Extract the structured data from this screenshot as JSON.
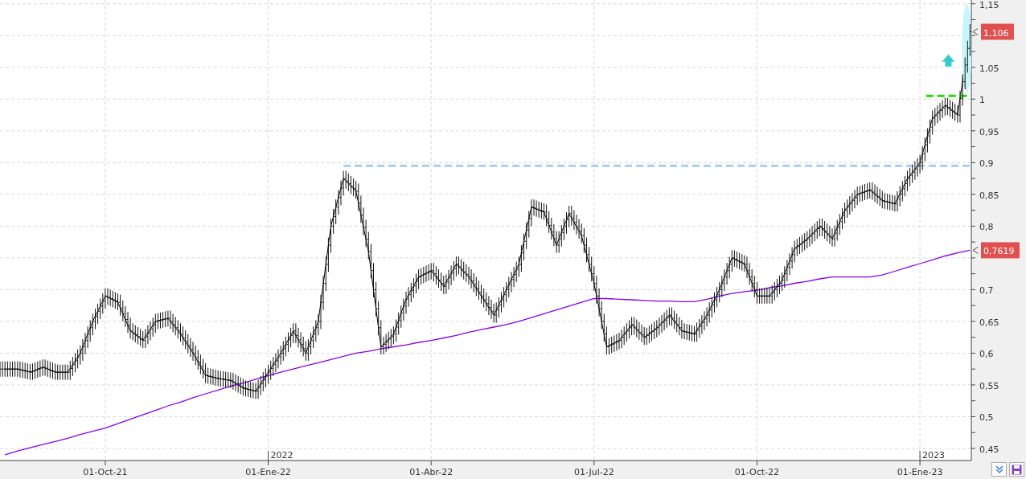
{
  "chart": {
    "chart_data": {
      "type": "line",
      "categories": [
        null,
        null,
        null,
        null,
        null,
        null,
        null,
        null,
        "01-Oct-21",
        null,
        null,
        null,
        null,
        null,
        null,
        null,
        null,
        null,
        null,
        null,
        null,
        "01-Ene-22",
        null,
        null,
        null,
        null,
        null,
        null,
        null,
        null,
        null,
        null,
        null,
        null,
        "01-Abr-22",
        null,
        null,
        null,
        null,
        null,
        null,
        null,
        null,
        null,
        null,
        null,
        null,
        "01-Jul-22",
        null,
        null,
        null,
        null,
        null,
        null,
        null,
        null,
        null,
        null,
        null,
        null,
        "01-Oct-22",
        null,
        null,
        null,
        null,
        null,
        null,
        null,
        null,
        null,
        null,
        null,
        null,
        "01-Ene-23",
        null,
        null,
        null,
        null
      ],
      "ylim": [
        0.431,
        1.156
      ],
      "yticks": [
        {
          "value": 0.45,
          "label": "0,45"
        },
        {
          "value": 0.5,
          "label": "0,5"
        },
        {
          "value": 0.55,
          "label": "0,55"
        },
        {
          "value": 0.6,
          "label": "0,6"
        },
        {
          "value": 0.65,
          "label": "0,65"
        },
        {
          "value": 0.7,
          "label": "0,7"
        },
        {
          "value": 0.8,
          "label": "0,8"
        },
        {
          "value": 0.85,
          "label": "0,85"
        },
        {
          "value": 0.9,
          "label": "0,9"
        },
        {
          "value": 0.95,
          "label": "0,95"
        },
        {
          "value": 1,
          "label": "1"
        },
        {
          "value": 1.05,
          "label": "1,05"
        },
        {
          "value": 1.15,
          "label": "1,15"
        }
      ],
      "series": [
        {
          "color": "#000000",
          "values": [
            0.575,
            0.575,
            0.57,
            0.578,
            0.57,
            0.57,
            0.6,
            0.65,
            0.69,
            0.68,
            0.635,
            0.62,
            0.65,
            0.655,
            0.63,
            0.6,
            0.565,
            0.56,
            0.557,
            0.545,
            0.54,
            0.57,
            0.6,
            0.635,
            0.6,
            0.65,
            0.8,
            0.875,
            0.855,
            0.76,
            0.61,
            0.63,
            0.685,
            0.72,
            0.73,
            0.705,
            0.74,
            0.72,
            0.69,
            0.66,
            0.7,
            0.74,
            0.83,
            0.822,
            0.77,
            0.82,
            0.785,
            0.71,
            0.61,
            0.62,
            0.645,
            0.625,
            0.64,
            0.66,
            0.635,
            0.63,
            0.66,
            0.7,
            0.75,
            0.74,
            0.69,
            0.69,
            0.715,
            0.765,
            0.78,
            0.8,
            0.78,
            0.825,
            0.85,
            0.857,
            0.84,
            0.835,
            0.875,
            0.9,
            0.97,
            0.99,
            0.975,
            1.106
          ]
        },
        {
          "color": "#8800ee",
          "values": [
            0.44,
            0.446,
            0.451,
            0.456,
            0.461,
            0.466,
            0.472,
            0.477,
            0.482,
            0.489,
            0.496,
            0.503,
            0.51,
            0.517,
            0.523,
            0.53,
            0.536,
            0.542,
            0.548,
            0.553,
            0.559,
            0.565,
            0.57,
            0.575,
            0.58,
            0.585,
            0.59,
            0.595,
            0.6,
            0.603,
            0.607,
            0.61,
            0.613,
            0.617,
            0.62,
            0.624,
            0.628,
            0.633,
            0.637,
            0.641,
            0.645,
            0.65,
            0.656,
            0.662,
            0.668,
            0.674,
            0.68,
            0.686,
            0.686,
            0.685,
            0.684,
            0.683,
            0.682,
            0.682,
            0.681,
            0.681,
            0.685,
            0.69,
            0.694,
            0.697,
            0.699,
            0.703,
            0.706,
            0.71,
            0.713,
            0.717,
            0.72,
            0.72,
            0.72,
            0.72,
            0.723,
            0.729,
            0.735,
            0.741,
            0.747,
            0.753,
            0.758,
            0.762
          ]
        }
      ],
      "grid": true
    },
    "level_lines": [
      {
        "color": "#a9ccf2"
      },
      {
        "color": "#22dd00"
      }
    ],
    "price_tags": [
      {
        "label": "1,106",
        "color": "#e05050"
      },
      {
        "label": "0,7619",
        "color": "#e05050"
      }
    ],
    "year_markers": [
      {
        "label": "2022"
      },
      {
        "label": "2023"
      }
    ],
    "markers": [
      {
        "kind": "ellipse",
        "color": "#c6f6fb"
      },
      {
        "kind": "arrow",
        "color": "#33cccc"
      }
    ]
  },
  "toolbar": {
    "buttons": [
      {
        "kind": "collapse"
      },
      {
        "kind": "save"
      }
    ]
  }
}
